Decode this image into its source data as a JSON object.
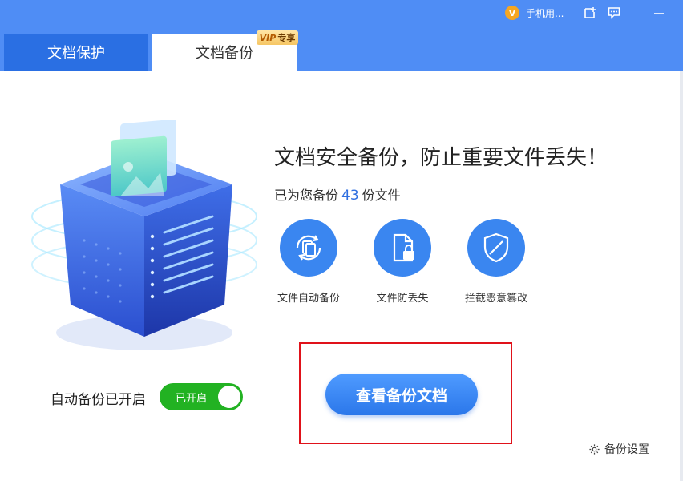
{
  "header": {
    "account_label": "手机用...",
    "account_badge": "V",
    "icons": [
      "add-square-icon",
      "feedback-icon",
      "minimize-icon"
    ]
  },
  "tabs": [
    {
      "label": "文档保护",
      "active": false
    },
    {
      "label": "文档备份",
      "active": true
    }
  ],
  "vip_badge": {
    "prefix": "VIP",
    "text": "专享"
  },
  "main": {
    "headline": "文档安全备份，防止重要文件丢失！",
    "count_prefix": "已为您备份",
    "count_value": "43",
    "count_suffix": "份文件",
    "features": [
      {
        "label": "文件自动备份",
        "icon": "auto-backup-icon"
      },
      {
        "label": "文件防丢失",
        "icon": "file-lock-icon"
      },
      {
        "label": "拦截恶意篡改",
        "icon": "shield-icon"
      }
    ],
    "toggle_label": "自动备份已开启",
    "toggle_state_text": "已开启",
    "primary_button": "查看备份文档",
    "settings_link": "备份设置"
  },
  "colors": {
    "header_blue": "#4f8df5",
    "active_tab_blue": "#2a6fe3",
    "feature_circle": "#3a86f0",
    "toggle_green": "#22b222",
    "highlight_red": "#e0121a",
    "count_blue": "#2f6fe0"
  }
}
